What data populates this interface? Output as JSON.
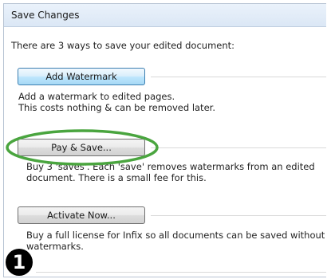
{
  "dialog": {
    "title": "Save Changes",
    "intro": "There are 3 ways to save your edited document:"
  },
  "options": [
    {
      "button_label": "Add Watermark",
      "description_line1": "Add a watermark to edited pages.",
      "description_line2": "This costs nothing & can be removed later."
    },
    {
      "button_label": "Pay & Save...",
      "description_line1": "Buy 3 'saves'. Each 'save' removes watermarks from an edited",
      "description_line2": "document. There is a small fee for this."
    },
    {
      "button_label": "Activate Now...",
      "description_line1": "Buy a full license for Infix so all documents can be saved without",
      "description_line2": "watermarks."
    }
  ],
  "annotation": {
    "step_number": "1",
    "highlight_color": "#4aa53f"
  },
  "colors": {
    "title_bar": "#dbe7f5",
    "primary_button_border": "#3c7fb1"
  }
}
